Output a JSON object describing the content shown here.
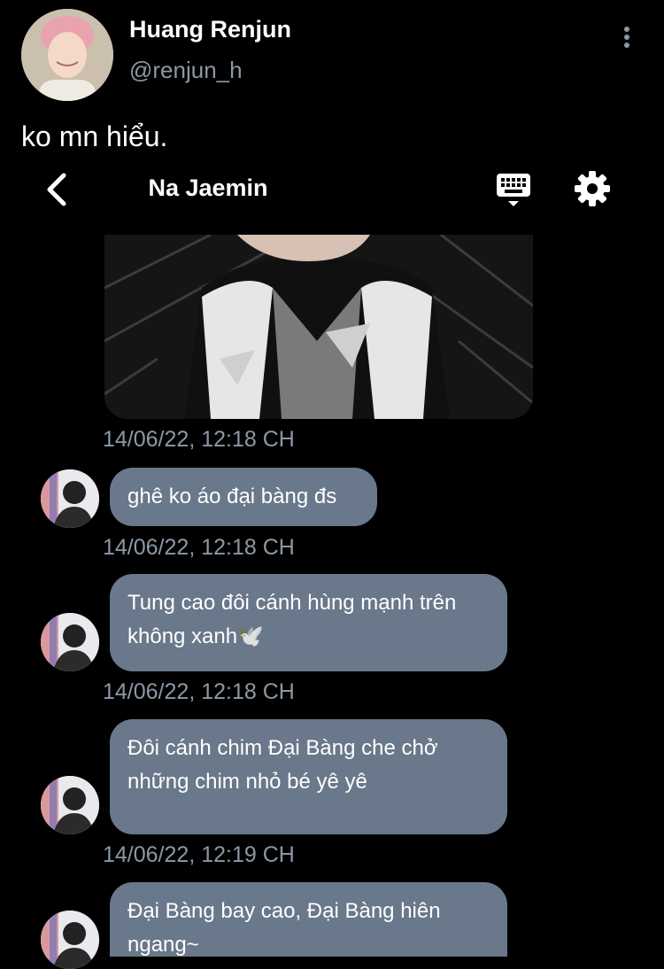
{
  "tweet": {
    "display_name": "Huang Renjun",
    "handle": "@renjun_h",
    "text": "ko mn hiểu."
  },
  "chat": {
    "title": "Na Jaemin",
    "messages": [
      {
        "text": "ghê ko áo đại bàng đs",
        "timestamp": "14/06/22, 12:18 CH"
      },
      {
        "text": "Tung cao đôi cánh hùng mạnh trên không xanh🕊️",
        "timestamp": "14/06/22, 12:18 CH"
      },
      {
        "text": "Đôi cánh chim Đại Bàng che chở những chim nhỏ bé yê yê",
        "timestamp": "14/06/22, 12:19 CH"
      },
      {
        "text": "Đại Bàng bay cao, Đại Bàng hiên ngang~"
      }
    ],
    "photo_timestamp": "14/06/22, 12:18 CH"
  },
  "icons": {
    "back": "chevron-left-icon",
    "keyboard": "keyboard-icon",
    "settings": "gear-icon",
    "more": "more-vertical-icon"
  },
  "colors": {
    "background": "#000000",
    "bubble": "#69788a",
    "secondary_text": "#8b98a5"
  }
}
